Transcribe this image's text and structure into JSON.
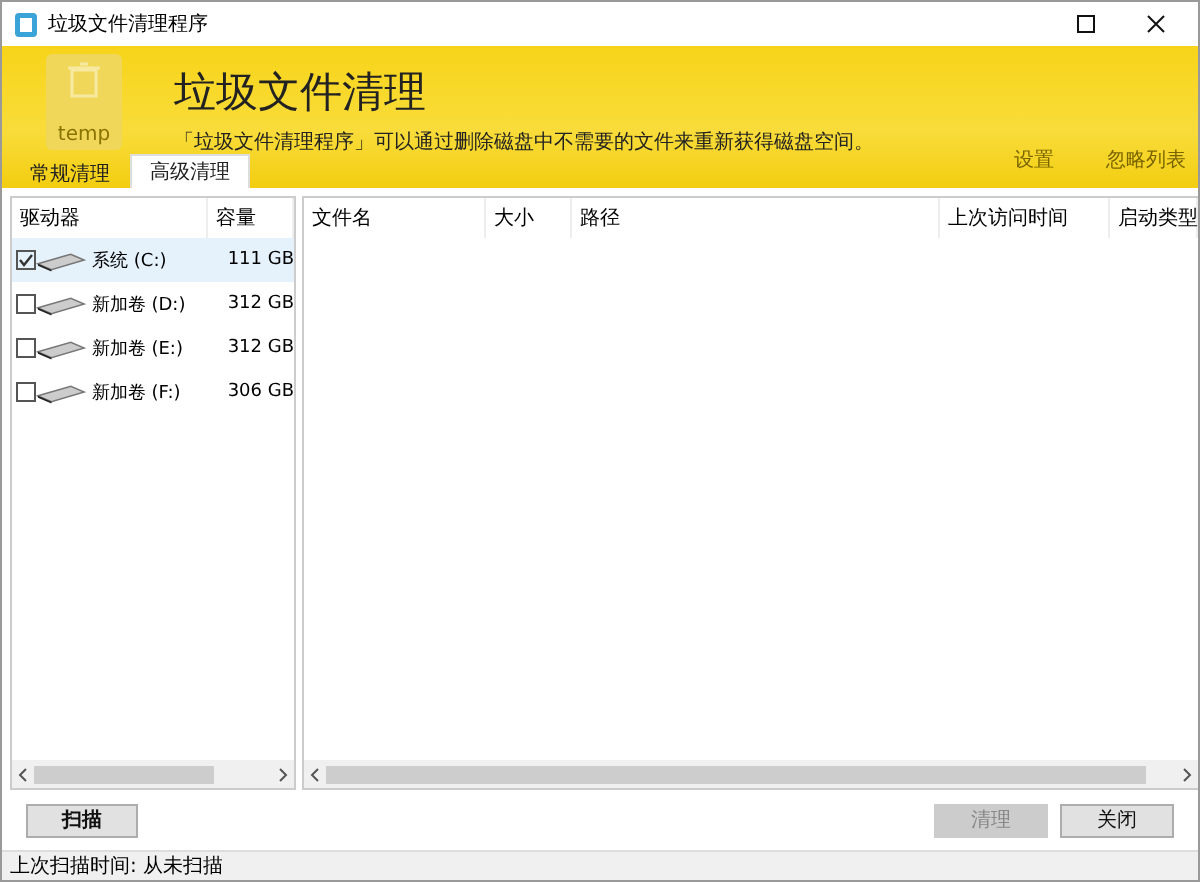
{
  "window": {
    "title": "垃圾文件清理程序"
  },
  "banner": {
    "heading": "垃圾文件清理",
    "description": "「垃圾文件清理程序」可以通过删除磁盘中不需要的文件来重新获得磁盘空间。",
    "icon_label": "temp",
    "links": [
      "设置",
      "忽略列表"
    ]
  },
  "tabs": [
    {
      "label": "常规清理",
      "selected": false
    },
    {
      "label": "高级清理",
      "selected": true
    }
  ],
  "drives": {
    "columns": [
      "驱动器",
      "容量"
    ],
    "rows": [
      {
        "name": "系统 (C:)",
        "capacity": "111 GB",
        "checked": true,
        "selected": true
      },
      {
        "name": "新加卷 (D:)",
        "capacity": "312 GB",
        "checked": false,
        "selected": false
      },
      {
        "name": "新加卷 (E:)",
        "capacity": "312 GB",
        "checked": false,
        "selected": false
      },
      {
        "name": "新加卷 (F:)",
        "capacity": "306 GB",
        "checked": false,
        "selected": false
      }
    ]
  },
  "files": {
    "columns": [
      "文件名",
      "大小",
      "路径",
      "上次访问时间",
      "启动类型"
    ]
  },
  "buttons": [
    {
      "label": "扫描",
      "disabled": false
    },
    {
      "label": "清理",
      "disabled": true
    },
    {
      "label": "关闭",
      "disabled": false
    }
  ],
  "status_bar": "上次扫描时间: 从未扫描"
}
